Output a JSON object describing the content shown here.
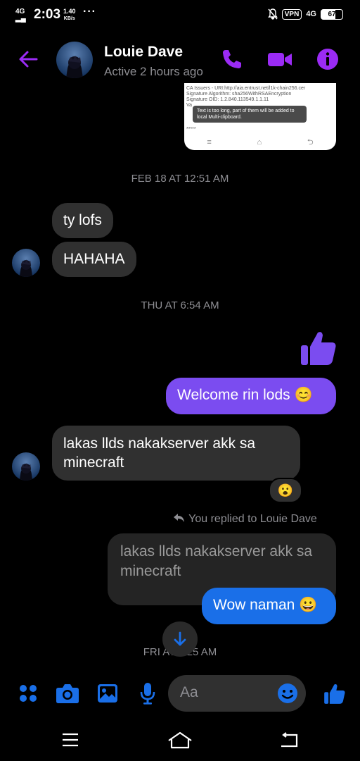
{
  "status_bar": {
    "network": "4G",
    "time": "2:03",
    "speed_value": "1.40",
    "speed_unit": "KB/s",
    "dots": "···",
    "vpn": "VPN",
    "network2": "4G",
    "battery": "67"
  },
  "header": {
    "name": "Louie Dave",
    "status": "Active 2 hours ago"
  },
  "screenshot_preview": {
    "lines": [
      "CA Issuers - URI:http://aia.entrust.net/l1k-chain256.cer",
      "Signature Algorithm: sha256WithRSAEncryption",
      "Signature OID: 1.2.840.113549.1.1.11",
      "Va"
    ],
    "toast": "Text is too long, part of them will be added to local Multi-clipboard.",
    "tail": "*****"
  },
  "timestamps": {
    "t1": "FEB 18 AT 12:51 AM",
    "t2": "THU AT 6:54 AM",
    "t3": "FRI AT 1:25 AM"
  },
  "messages": {
    "m1": "ty lofs",
    "m2": "HAHAHA",
    "m3": "Welcome rin lods 😊",
    "m4": "lakas llds nakakserver akk sa minecraft",
    "m4_reaction": "😮",
    "replied_label": "You replied to Louie Dave",
    "quoted": "lakas llds nakakserver akk sa minecraft",
    "m5": "Wow naman 😀"
  },
  "composer": {
    "placeholder": "Aa"
  },
  "colors": {
    "accent_purple": "#9b2bf5",
    "accent_blue": "#1a6fe8",
    "bubble_purple": "#7b4cf0"
  }
}
